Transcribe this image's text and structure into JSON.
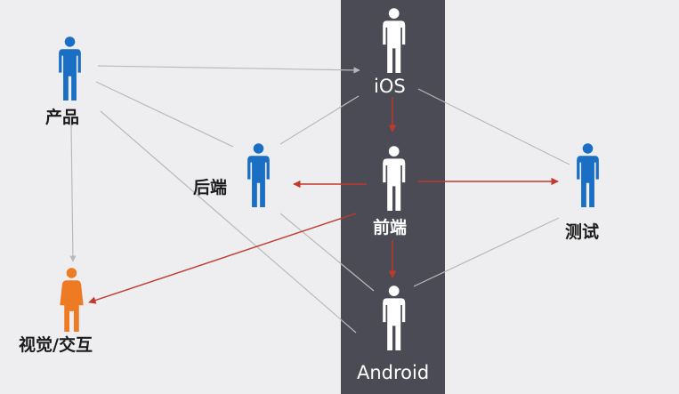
{
  "roles": {
    "product": {
      "label": "产品",
      "color": "#1a6fc4"
    },
    "backend": {
      "label": "后端",
      "color": "#1a6fc4"
    },
    "visual": {
      "label": "视觉/交互",
      "color": "#ee7a24"
    },
    "ios": {
      "label": "iOS",
      "color": "#ffffff"
    },
    "frontend": {
      "label": "前端",
      "color": "#ffffff"
    },
    "android": {
      "label": "Android",
      "color": "#ffffff"
    },
    "testing": {
      "label": "测试",
      "color": "#1a6fc4"
    }
  },
  "colors": {
    "background": "#eeeef0",
    "column": "#4a4b54",
    "grey_line": "#b9b9bd",
    "red_line": "#c0392b"
  },
  "edges": [
    {
      "from": "product",
      "to": "ios",
      "style": "grey",
      "arrow": true
    },
    {
      "from": "product",
      "to": "backend",
      "style": "grey",
      "arrow": false
    },
    {
      "from": "product",
      "to": "visual",
      "style": "grey",
      "arrow": true
    },
    {
      "from": "product",
      "to": "android",
      "style": "grey",
      "arrow": false
    },
    {
      "from": "ios",
      "to": "backend",
      "style": "grey",
      "arrow": false
    },
    {
      "from": "ios",
      "to": "testing",
      "style": "grey",
      "arrow": false
    },
    {
      "from": "backend",
      "to": "android",
      "style": "grey",
      "arrow": false
    },
    {
      "from": "android",
      "to": "testing",
      "style": "grey",
      "arrow": false
    },
    {
      "from": "ios",
      "to": "frontend",
      "style": "red",
      "arrow": true
    },
    {
      "from": "frontend",
      "to": "android",
      "style": "red",
      "arrow": true
    },
    {
      "from": "frontend",
      "to": "backend",
      "style": "red",
      "arrow": true
    },
    {
      "from": "frontend",
      "to": "testing",
      "style": "red",
      "arrow": true
    },
    {
      "from": "frontend",
      "to": "visual",
      "style": "red",
      "arrow": true
    }
  ]
}
